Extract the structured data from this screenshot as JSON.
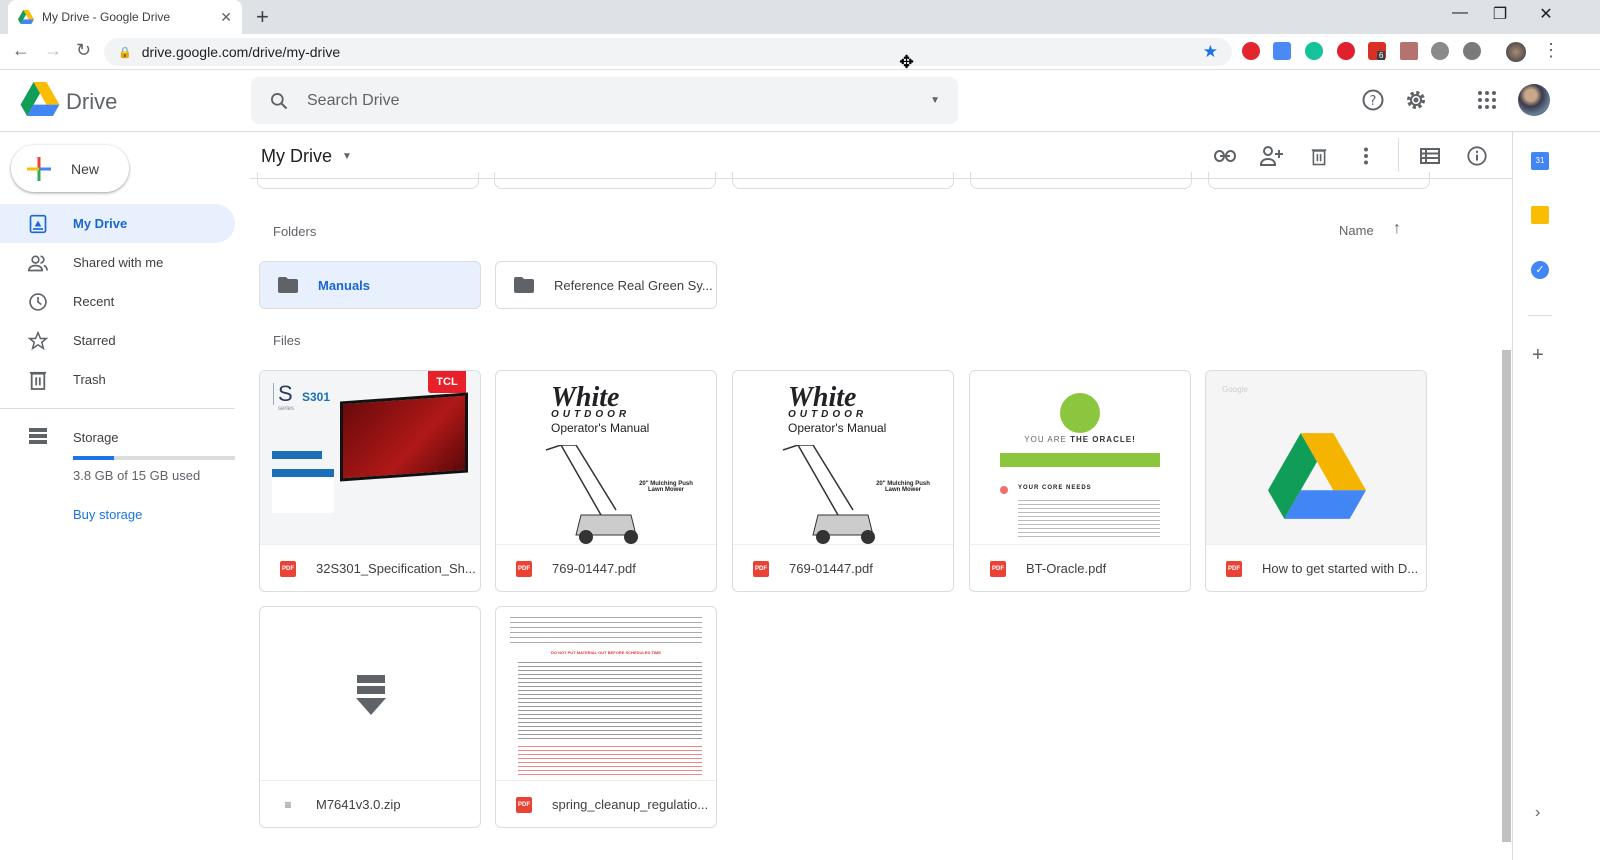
{
  "browser": {
    "tab_title": "My Drive - Google Drive",
    "url": "drive.google.com/drive/my-drive",
    "extension_badge": "6"
  },
  "app": {
    "name": "Drive",
    "search_placeholder": "Search Drive"
  },
  "sidebar": {
    "new_label": "New",
    "items": [
      {
        "label": "My Drive",
        "icon": "my-drive-icon",
        "active": true
      },
      {
        "label": "Shared with me",
        "icon": "people-icon"
      },
      {
        "label": "Recent",
        "icon": "clock-icon"
      },
      {
        "label": "Starred",
        "icon": "star-icon"
      },
      {
        "label": "Trash",
        "icon": "trash-icon"
      }
    ],
    "storage": {
      "label": "Storage",
      "used_text": "3.8 GB of 15 GB used",
      "used_fraction": 0.25,
      "buy_label": "Buy storage"
    }
  },
  "main": {
    "title": "My Drive",
    "folders_label": "Folders",
    "files_label": "Files",
    "sort_label": "Name",
    "folders": [
      {
        "name": "Manuals",
        "selected": true
      },
      {
        "name": "Reference Real Green Sy..."
      }
    ],
    "files": [
      {
        "name": "32S301_Specification_Sh...",
        "type": "pdf",
        "thumb": "tcl"
      },
      {
        "name": "769-01447.pdf",
        "type": "pdf",
        "thumb": "white"
      },
      {
        "name": "769-01447.pdf",
        "type": "pdf",
        "thumb": "white"
      },
      {
        "name": "BT-Oracle.pdf",
        "type": "pdf",
        "thumb": "oracle"
      },
      {
        "name": "How to get started with D...",
        "type": "pdf",
        "thumb": "drive"
      },
      {
        "name": "M7641v3.0.zip",
        "type": "zip",
        "thumb": "zip"
      },
      {
        "name": "spring_cleanup_regulatio...",
        "type": "pdf",
        "thumb": "doc"
      }
    ],
    "thumb_text": {
      "tcl_brand": "TCL",
      "tcl_series_letter": "S",
      "tcl_model": "S301",
      "tcl_series_word": "series",
      "white_brand": "White",
      "white_sub": "OUTDOOR",
      "white_manual": "Operator's Manual",
      "white_desc": "20\" Mulching Push Lawn Mower",
      "oracle_title_a": "YOU ARE ",
      "oracle_title_b": "THE ORACLE!",
      "oracle_core": "YOUR CORE NEEDS",
      "drive_google": "Google",
      "doc_warning": "DO NOT PUT MATERIAL OUT BEFORE SCHEDULED TIME"
    }
  },
  "colors": {
    "accent": "#1a73e8",
    "active_bg": "#e8f0fe",
    "pdf_red": "#ea4335"
  }
}
